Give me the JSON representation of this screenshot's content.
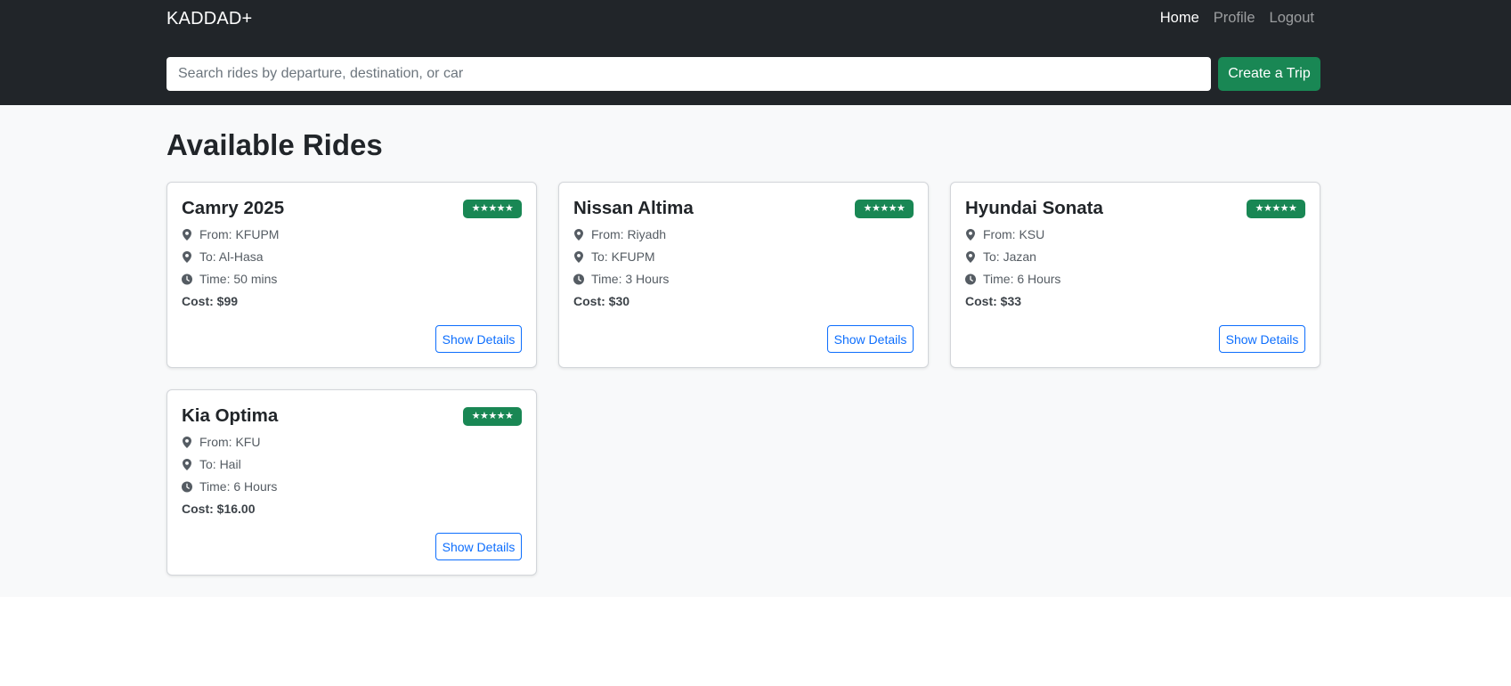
{
  "navbar": {
    "brand": "KADDAD+",
    "links": [
      {
        "label": "Home"
      },
      {
        "label": "Profile"
      },
      {
        "label": "Logout"
      }
    ],
    "search_placeholder": "Search rides by departure, destination, or car",
    "create_label": "Create a Trip"
  },
  "main": {
    "title": "Available Rides",
    "rides": [
      {
        "car": "Camry 2025",
        "rating": "★★★★★",
        "from": "From: KFUPM",
        "to": "To: Al-Hasa",
        "time": "Time: 50 mins",
        "cost_label": "Cost:",
        "cost_value": "$99",
        "button": "Show Details"
      },
      {
        "car": "Nissan Altima",
        "rating": "★★★★★",
        "from": "From: Riyadh",
        "to": "To: KFUPM",
        "time": "Time: 3 Hours",
        "cost_label": "Cost:",
        "cost_value": "$30",
        "button": "Show Details"
      },
      {
        "car": "Hyundai Sonata",
        "rating": "★★★★★",
        "from": "From: KSU",
        "to": "To: Jazan",
        "time": "Time: 6 Hours",
        "cost_label": "Cost:",
        "cost_value": "$33",
        "button": "Show Details"
      },
      {
        "car": "Kia Optima",
        "rating": "★★★★★",
        "from": "From: KFU",
        "to": "To: Hail",
        "time": "Time: 6 Hours",
        "cost_label": "Cost:",
        "cost_value": "$16.00",
        "button": "Show Details"
      }
    ]
  },
  "icons": {
    "location": "map-pin-icon",
    "time": "clock-icon"
  },
  "colors": {
    "navbar": "#212529",
    "accent_green": "#198754",
    "primary_blue": "#0d6efd",
    "page_bg": "#f8f9fa"
  }
}
